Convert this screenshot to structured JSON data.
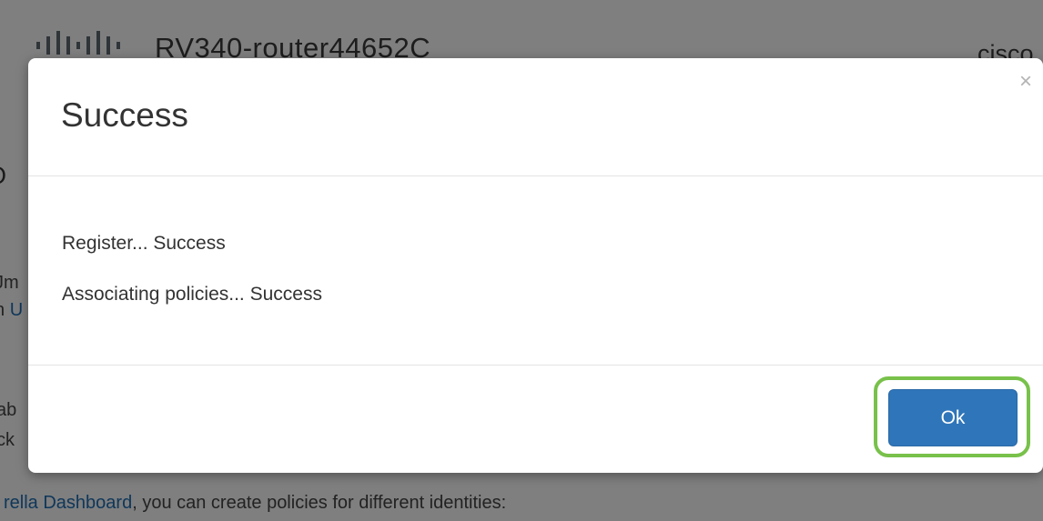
{
  "app_header": {
    "device_name": "RV340-router44652C",
    "brand": "cisco"
  },
  "background": {
    "heading_fragment": "O",
    "line1_fragment": "Jm",
    "line2_prefix": "n",
    "line2_link": "U",
    "line3_fragment": "ab",
    "line4_fragment": "ck",
    "bottom_link": "rella Dashboard",
    "bottom_text": ", you can create policies for different identities:"
  },
  "modal": {
    "title": "Success",
    "close_glyph": "×",
    "messages": [
      "Register... Success",
      "Associating policies... Success"
    ],
    "ok_label": "Ok"
  },
  "colors": {
    "primary_button": "#2f75b9",
    "highlight_ring": "#78c14a",
    "link": "#1e6fb5",
    "overlay": "rgba(0,0,0,0.5)"
  },
  "icons": {
    "logo": "cisco-logo-icon",
    "close": "close-icon"
  }
}
